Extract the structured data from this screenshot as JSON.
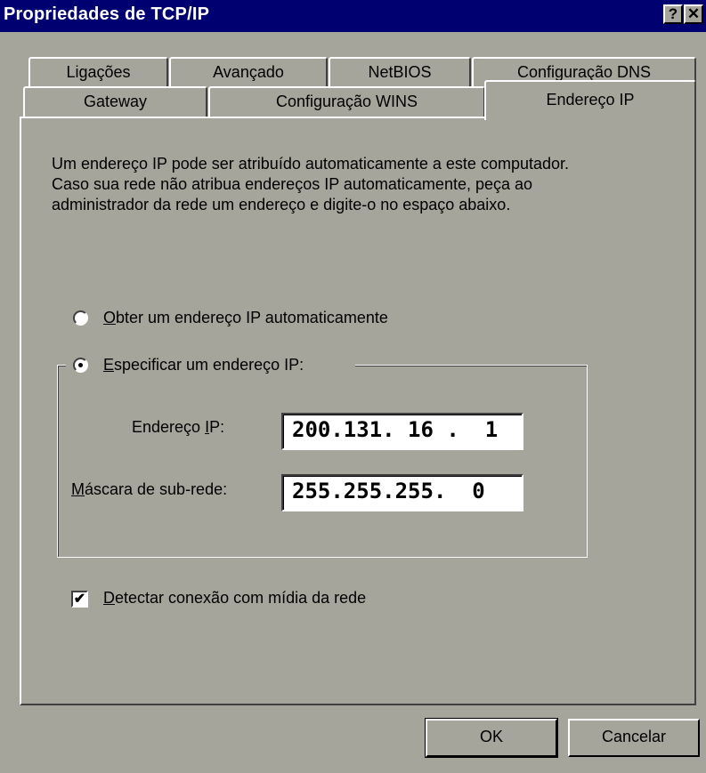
{
  "window": {
    "title": "Propriedades de TCP/IP",
    "help_button": "?",
    "close_button": "✕"
  },
  "tabs": {
    "back_row": [
      "Ligações",
      "Avançado",
      "NetBIOS",
      "Configuração DNS"
    ],
    "front_row": [
      "Gateway",
      "Configuração WINS",
      "Endereço IP"
    ],
    "active": "Endereço IP"
  },
  "description": "Um endereço IP pode ser atribuído automaticamente a este computador. Caso sua rede não atribua endereços IP automaticamente, peça ao administrador da rede um endereço e digite-o no espaço abaixo.",
  "options": {
    "auto_ip": {
      "mnemonic": "O",
      "label": "bter um endereço IP automaticamente",
      "selected": false
    },
    "specify_ip": {
      "mnemonic": "E",
      "label": "specificar um endereço IP:",
      "selected": true
    }
  },
  "fields": {
    "ip_address": {
      "label_before": "Endereço ",
      "mnemonic": "I",
      "label_after": "P:",
      "value": "200.131. 16 .  1"
    },
    "subnet_mask": {
      "mnemonic": "M",
      "label_after": "áscara de sub-rede:",
      "value": "255.255.255.  0"
    }
  },
  "detect_media": {
    "mnemonic": "D",
    "label": "etectar conexão com mídia da rede",
    "checked": true,
    "check_glyph": "✔"
  },
  "buttons": {
    "ok": "OK",
    "cancel": "Cancelar"
  },
  "colors": {
    "face": "#a5a59c",
    "titlebar": "#000070"
  }
}
